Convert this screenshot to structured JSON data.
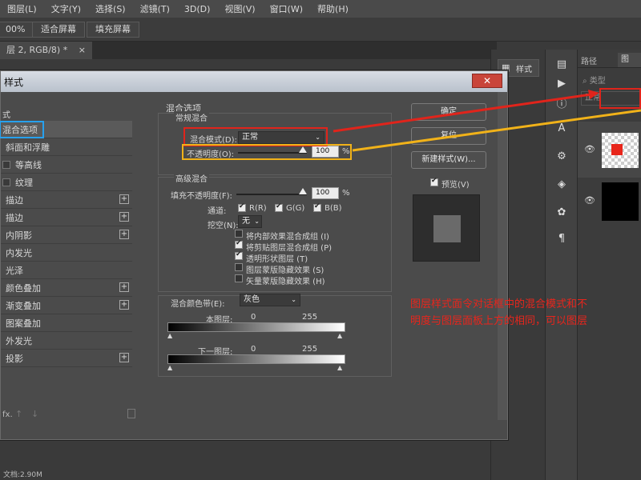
{
  "menubar": {
    "items": [
      "图层(L)",
      "文字(Y)",
      "选择(S)",
      "滤镜(T)",
      "3D(D)",
      "视图(V)",
      "窗口(W)",
      "帮助(H)"
    ]
  },
  "options_bar": {
    "zoom": "00%",
    "fit_screen": "适合屏幕",
    "fill_screen": "填充屏幕"
  },
  "doc_tab": {
    "label": "层 2, RGB/8) *",
    "close": "×"
  },
  "dialog": {
    "title": "样式",
    "close_glyph": "✕",
    "styles_header": "式",
    "styles": [
      {
        "label": "混合选项",
        "has_check": false,
        "has_plus": false,
        "selected": true
      },
      {
        "label": "斜面和浮雕",
        "has_check": true,
        "has_plus": false
      },
      {
        "label": "等高线",
        "has_check": true,
        "has_plus": false
      },
      {
        "label": "纹理",
        "has_check": true,
        "has_plus": false
      },
      {
        "label": "描边",
        "has_check": true,
        "has_plus": true
      },
      {
        "label": "描边",
        "has_check": true,
        "has_plus": true
      },
      {
        "label": "内阴影",
        "has_check": true,
        "has_plus": true
      },
      {
        "label": "内发光",
        "has_check": true,
        "has_plus": false
      },
      {
        "label": "光泽",
        "has_check": true,
        "has_plus": false
      },
      {
        "label": "颜色叠加",
        "has_check": true,
        "has_plus": true
      },
      {
        "label": "渐变叠加",
        "has_check": true,
        "has_plus": true
      },
      {
        "label": "图案叠加",
        "has_check": true,
        "has_plus": false
      },
      {
        "label": "外发光",
        "has_check": true,
        "has_plus": false
      },
      {
        "label": "投影",
        "has_check": true,
        "has_plus": true
      }
    ],
    "bottom_icons": [
      "fx",
      "↑",
      "↓",
      "trash"
    ],
    "blend_options_title": "混合选项",
    "normal_blend_title": "常规混合",
    "blend_mode_label": "混合模式(D):",
    "blend_mode_value": "正常",
    "opacity_label": "不透明度(O):",
    "opacity_value": "100",
    "percent": "%",
    "advanced_blend_title": "高级混合",
    "fill_opacity_label": "填充不透明度(F):",
    "fill_opacity_value": "100",
    "channels_label": "通道:",
    "channel_r": "R(R)",
    "channel_g": "G(G)",
    "channel_b": "B(B)",
    "knockout_label": "挖空(N):",
    "knockout_value": "无",
    "options": [
      {
        "label": "将内部效果混合成组 (I)",
        "checked": false
      },
      {
        "label": "将剪贴图层混合成组 (P)",
        "checked": true
      },
      {
        "label": "透明形状图层 (T)",
        "checked": true
      },
      {
        "label": "图层蒙版隐藏效果 (S)",
        "checked": false
      },
      {
        "label": "矢量蒙版隐藏效果 (H)",
        "checked": false
      }
    ],
    "blend_if_label": "混合颜色带(E):",
    "blend_if_value": "灰色",
    "this_layer_label": "本图层:",
    "this_layer_min": "0",
    "this_layer_max": "255",
    "underlying_label": "下一图层:",
    "underlying_min": "0",
    "underlying_max": "255",
    "ok_button": "确定",
    "reset_button": "复位",
    "new_style_button": "新建样式(W)...",
    "preview_label": "预览(V)",
    "preview_checked": true
  },
  "annotation": {
    "line1": "图层样式面令对话框中的混合模式和不",
    "line2": "明度与图层面板上方的相同，可以图层"
  },
  "right_panel": {
    "style_tab": "样式",
    "path_tab": "路径",
    "layer_tab": "图",
    "kind_label": "类型",
    "blend_mode_value": "正常",
    "tools": [
      "play",
      "info",
      "text-A",
      "cube",
      "palette",
      "paragraph"
    ]
  },
  "status": "文档:2.90M",
  "colors": {
    "red": "#e0241b",
    "yellow": "#f1b219",
    "blue": "#27a1ee"
  }
}
